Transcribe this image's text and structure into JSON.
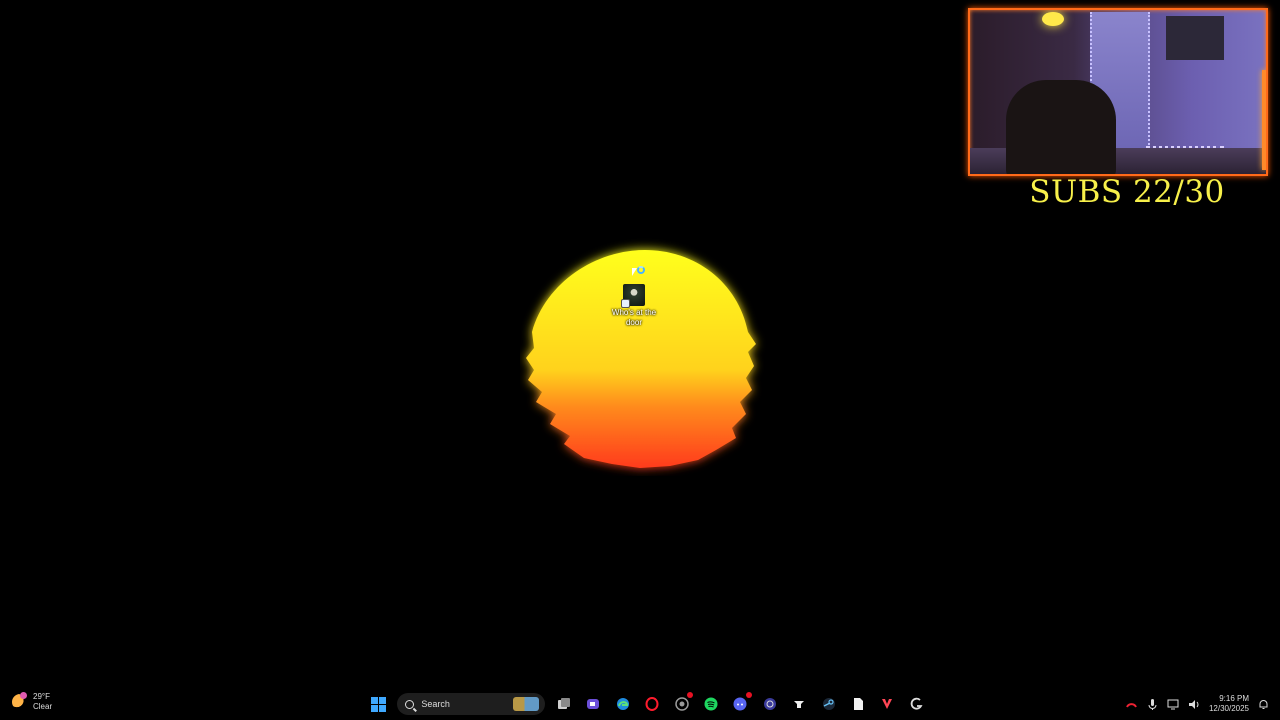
{
  "wallpaper": {
    "sun_colors": [
      "#ffff1a",
      "#ffd21e",
      "#ff8a1e",
      "#ff3b1e"
    ]
  },
  "desktop": {
    "icons": [
      {
        "label": "Who's at the door",
        "icon": "shortcut-game-icon"
      }
    ]
  },
  "overlay": {
    "subs_label": "SUBS 22/30",
    "accent_color": "#f7f04a",
    "frame_color": "#ff6a1a"
  },
  "taskbar": {
    "weather": {
      "temp": "29°F",
      "condition": "Clear",
      "icon": "moon-weather-icon"
    },
    "search_placeholder": "Search",
    "pinned": [
      {
        "name": "start",
        "icon": "windows-icon"
      },
      {
        "name": "task-view",
        "icon": "task-view-icon"
      },
      {
        "name": "clipchamp",
        "icon": "video-camera-icon"
      },
      {
        "name": "edge",
        "icon": "edge-browser-icon"
      },
      {
        "name": "opera-gx",
        "icon": "opera-icon"
      },
      {
        "name": "chrome",
        "icon": "chrome-icon"
      },
      {
        "name": "spotify",
        "icon": "spotify-icon"
      },
      {
        "name": "discord",
        "icon": "discord-icon",
        "badge": "1"
      },
      {
        "name": "obs",
        "icon": "obs-icon"
      },
      {
        "name": "streamlabs",
        "icon": "streamlabs-icon"
      },
      {
        "name": "steam",
        "icon": "steam-icon"
      },
      {
        "name": "file",
        "icon": "document-icon"
      },
      {
        "name": "valorant",
        "icon": "valorant-icon"
      },
      {
        "name": "logitech",
        "icon": "logitech-icon"
      }
    ],
    "clock": {
      "time": "9:16 PM",
      "date": "12/30/2025"
    }
  }
}
